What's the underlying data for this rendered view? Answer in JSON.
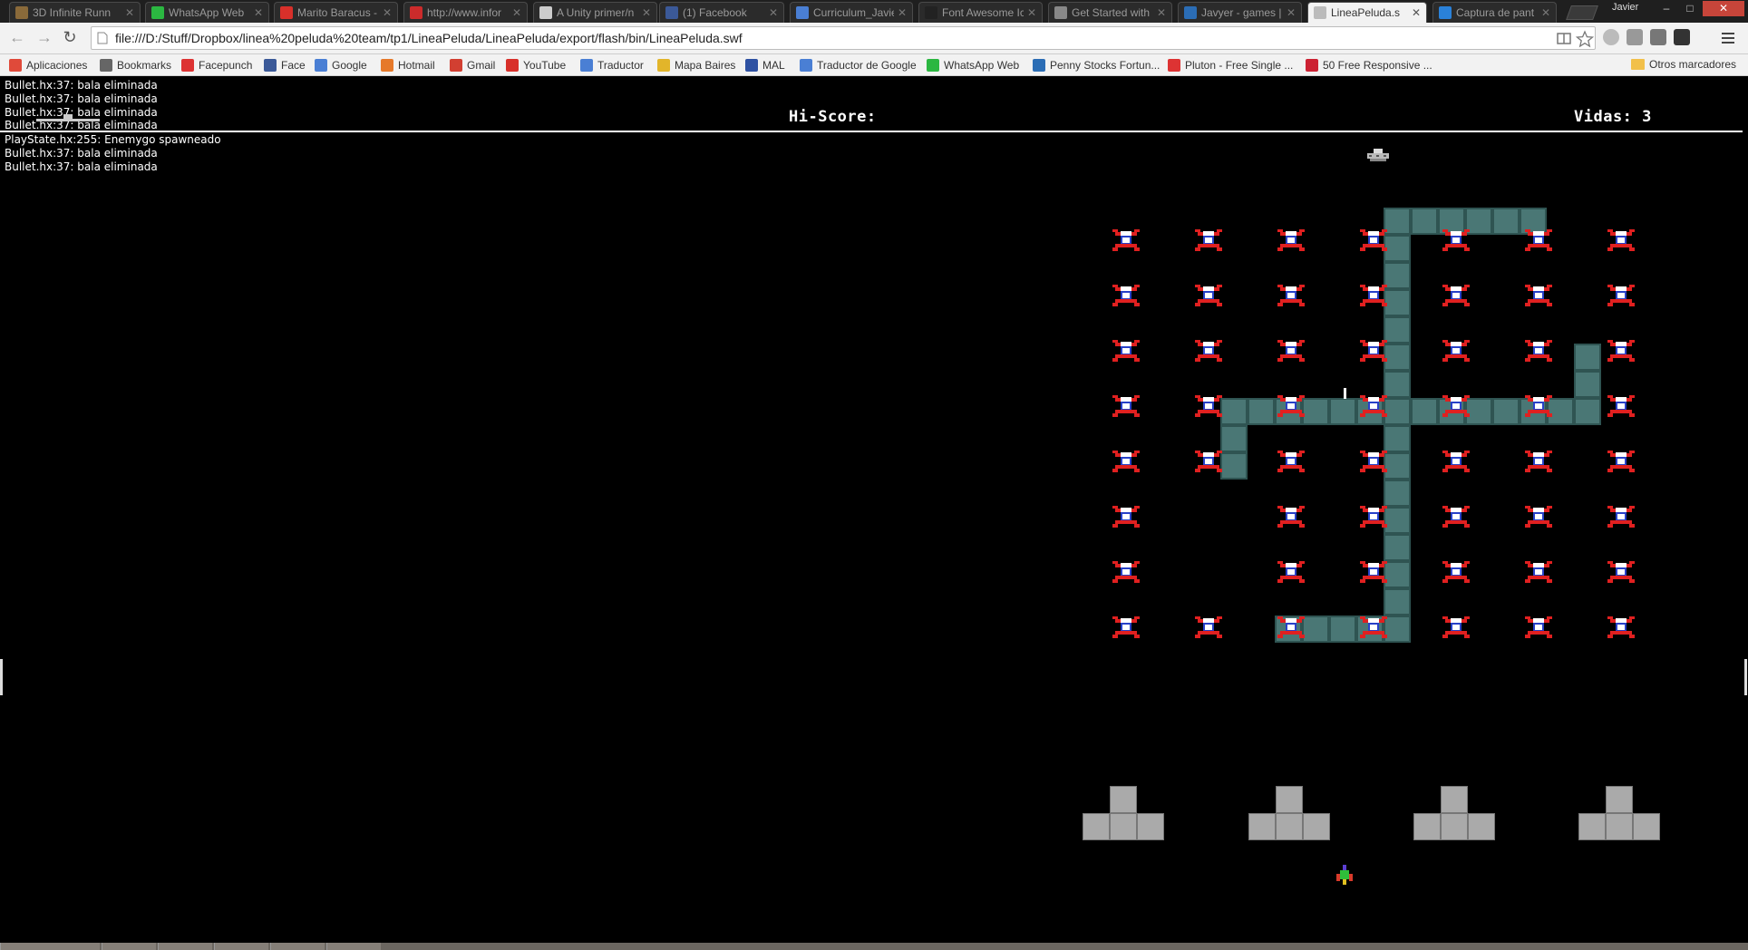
{
  "browser": {
    "tabs": [
      {
        "title": "3D Infinite Runn",
        "favicon": "unity-icon",
        "color": "#8a6a3a"
      },
      {
        "title": "WhatsApp Web",
        "favicon": "whatsapp-icon",
        "color": "#2bb741"
      },
      {
        "title": "Marito Baracus -",
        "favicon": "youtube-icon",
        "color": "#d8302a"
      },
      {
        "title": "http://www.infor",
        "favicon": "infobae-icon",
        "color": "#cc2b2b"
      },
      {
        "title": "A Unity primer/n",
        "favicon": "page-icon",
        "color": "#cccccc"
      },
      {
        "title": "(1) Facebook",
        "favicon": "facebook-icon",
        "color": "#3b5998"
      },
      {
        "title": "Curriculum_Javie",
        "favicon": "docs-icon",
        "color": "#4a7fd4"
      },
      {
        "title": "Font Awesome Ic",
        "favicon": "flag-icon",
        "color": "#222222"
      },
      {
        "title": "Get Started with",
        "favicon": "page-icon",
        "color": "#888888"
      },
      {
        "title": "Javyer - games |",
        "favicon": "itch-icon",
        "color": "#2b6db5"
      },
      {
        "title": "LineaPeluda.s",
        "favicon": "page-icon",
        "color": "#bbbbbb",
        "active": true
      },
      {
        "title": "Captura de pant",
        "favicon": "dropbox-icon",
        "color": "#2a81d9"
      }
    ],
    "user": "Javier",
    "window_buttons": {
      "minimize": "–",
      "maximize": "□",
      "close": "✕"
    },
    "nav": {
      "back": "←",
      "forward": "→",
      "reload": "↻"
    },
    "url": "file:///D:/Stuff/Dropbox/linea%20peluda%20team/tp1/LineaPeluda/LineaPeluda/export/flash/bin/LineaPeluda.swf",
    "bookmarks": [
      {
        "label": "Aplicaciones",
        "icon": "apps-grid-icon",
        "color": "#e04a3a"
      },
      {
        "label": "Bookmarks",
        "icon": "star-icon",
        "color": "#666666"
      },
      {
        "label": "Facepunch",
        "icon": "facepunch-icon",
        "color": "#d33"
      },
      {
        "label": "Face",
        "icon": "facebook-icon",
        "color": "#3b5998"
      },
      {
        "label": "Google",
        "icon": "google-icon",
        "color": "#4a7fd4"
      },
      {
        "label": "Hotmail",
        "icon": "windows-icon",
        "color": "#e6792a"
      },
      {
        "label": "Gmail",
        "icon": "gmail-icon",
        "color": "#d23f31"
      },
      {
        "label": "YouTube",
        "icon": "youtube-icon",
        "color": "#d8302a"
      },
      {
        "label": "Traductor",
        "icon": "translate-icon",
        "color": "#4a7fd4"
      },
      {
        "label": "Mapa Baires",
        "icon": "map-pin-icon",
        "color": "#e2b52a"
      },
      {
        "label": "MAL",
        "icon": "mal-icon",
        "color": "#2e51a2"
      },
      {
        "label": "Traductor de Google",
        "icon": "translate-icon",
        "color": "#4a7fd4"
      },
      {
        "label": "WhatsApp Web",
        "icon": "whatsapp-icon",
        "color": "#2bb741"
      },
      {
        "label": "Penny Stocks Fortun...",
        "icon": "globe-icon",
        "color": "#2b6db5"
      },
      {
        "label": "Pluton - Free Single ...",
        "icon": "pluton-icon",
        "color": "#d33"
      },
      {
        "label": "50 Free Responsive ...",
        "icon": "arrow-icon",
        "color": "#c23"
      }
    ],
    "other_bookmarks": "Otros marcadores"
  },
  "game": {
    "console": [
      "Bullet.hx:37: bala eliminada",
      "Bullet.hx:37: bala eliminada",
      "Bullet.hx:37: bala eliminada",
      "Bullet.hx:37: bala eliminada",
      "PlayState.hx:255: Enemygo spawneado",
      "Bullet.hx:37: bala eliminada",
      "Bullet.hx:37: bala eliminada"
    ],
    "hiscore_label": "Hi-Score:",
    "lives_label": "Vidas: 3",
    "colors": {
      "block": "#4a7775",
      "alien_red": "#e02020",
      "alien_blue": "#2840c8",
      "shield": "#aaaaaa"
    }
  }
}
